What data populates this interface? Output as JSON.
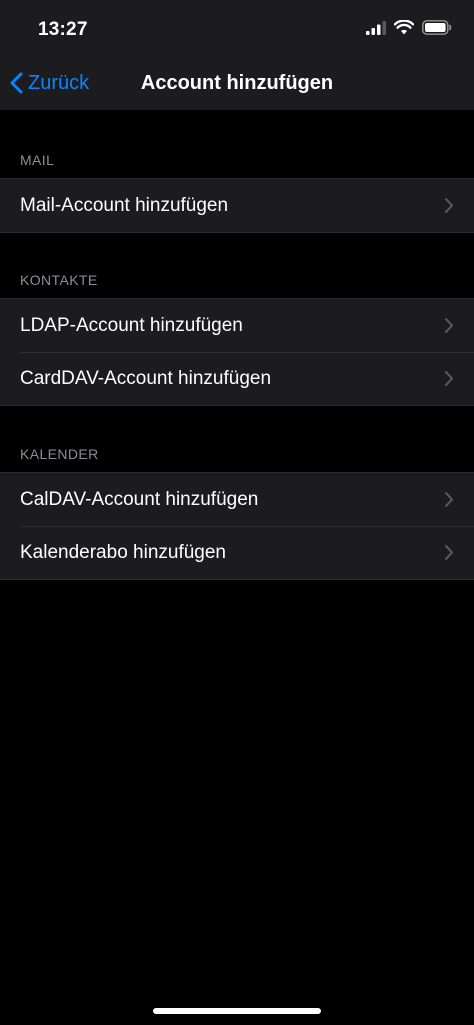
{
  "status_bar": {
    "time": "13:27"
  },
  "nav": {
    "back_label": "Zurück",
    "title": "Account hinzufügen"
  },
  "sections": [
    {
      "header": "MAIL",
      "items": [
        {
          "label": "Mail-Account hinzufügen"
        }
      ]
    },
    {
      "header": "KONTAKTE",
      "items": [
        {
          "label": "LDAP-Account hinzufügen"
        },
        {
          "label": "CardDAV-Account hinzufügen"
        }
      ]
    },
    {
      "header": "KALENDER",
      "items": [
        {
          "label": "CalDAV-Account hinzufügen"
        },
        {
          "label": "Kalenderabo hinzufügen"
        }
      ]
    }
  ],
  "colors": {
    "accent": "#0a84ff",
    "background": "#000000",
    "grouped_background": "#1c1c1e",
    "secondary_label": "#8d8d93"
  }
}
